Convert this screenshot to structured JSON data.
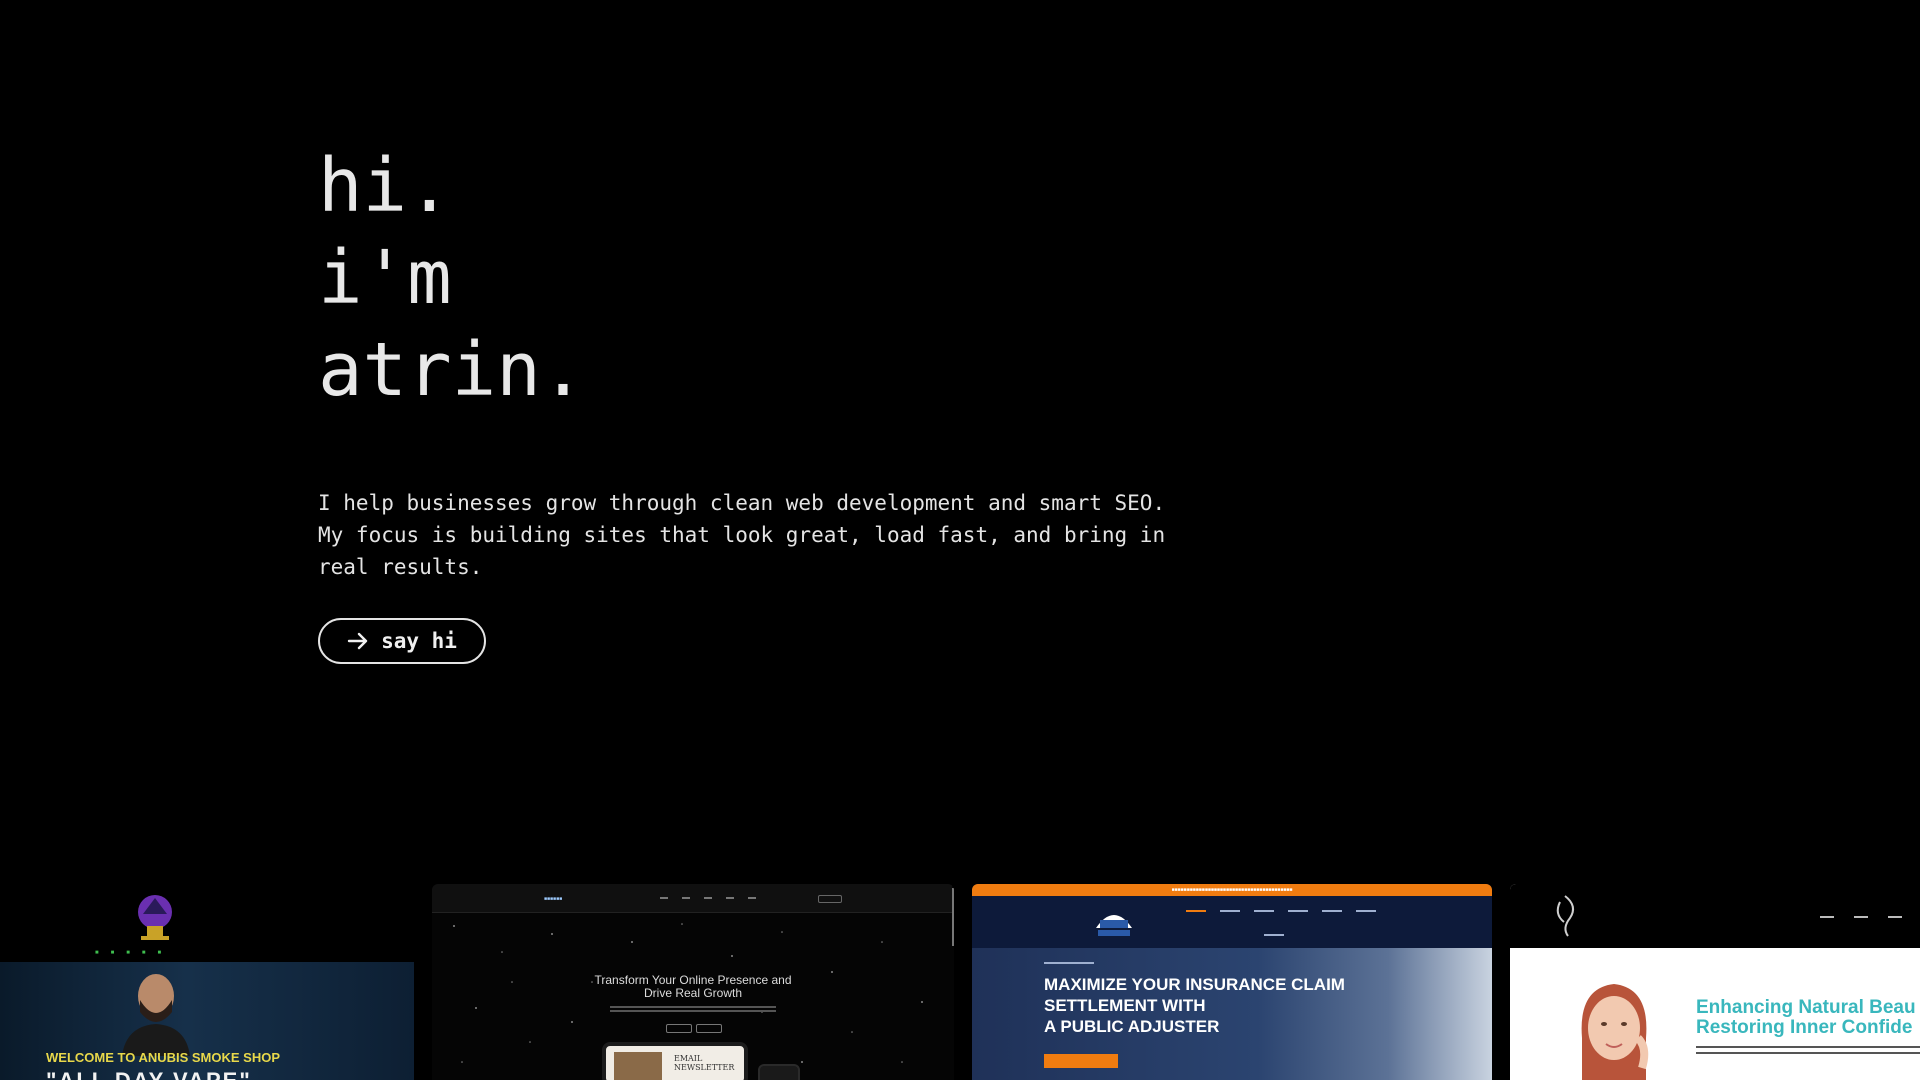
{
  "hero": {
    "line1": "hi.",
    "line2": "i'm",
    "line3": "atrin.",
    "intro": "I help businesses grow through clean web development and smart SEO.\nMy focus is building sites that look great, load fast, and bring in\nreal results.",
    "cta_label": "say hi",
    "cta_icon": "arrow-right-icon"
  },
  "portfolio": {
    "cards": [
      {
        "welcome": "WELCOME TO ANUBIS SMOKE SHOP",
        "big": "\"ALL DAY VAPE\""
      },
      {
        "headline": "Transform Your Online Presence and\nDrive Real Growth",
        "tablet_text": "EMAIL\nNEWSLETTER"
      },
      {
        "title": "MAXIMIZE YOUR INSURANCE CLAIM\nSETTLEMENT WITH\nA PUBLIC ADJUSTER"
      },
      {
        "title": "Enhancing Natural Beau\nRestoring Inner Confide"
      }
    ]
  },
  "colors": {
    "background": "#000000",
    "text": "#e6e6e6",
    "accent_orange": "#f07c10",
    "accent_teal": "#39b7bd"
  }
}
